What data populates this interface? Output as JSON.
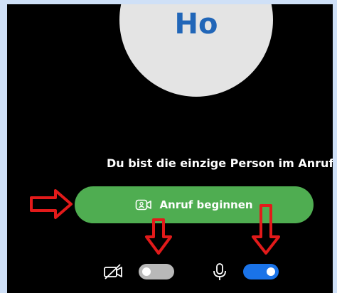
{
  "participant": {
    "initials": "Ho",
    "avatar_color": "#e4e4e4",
    "initials_color": "#2166b8"
  },
  "status": {
    "text": "Du bist die einzige Person im Anruf"
  },
  "call_button": {
    "label": "Anruf beginnen",
    "icon": "video-call-icon",
    "color": "#4fad51"
  },
  "controls": {
    "camera": {
      "icon": "camera-off-icon",
      "state": "off",
      "toggle_color": "#b8b8b8"
    },
    "microphone": {
      "icon": "microphone-icon",
      "state": "on",
      "toggle_color": "#1a73e8"
    }
  },
  "annotations": {
    "arrow_color": "#e21a1a",
    "arrows": [
      "arrow-to-call-button",
      "arrow-to-camera-toggle",
      "arrow-to-microphone-toggle"
    ]
  }
}
